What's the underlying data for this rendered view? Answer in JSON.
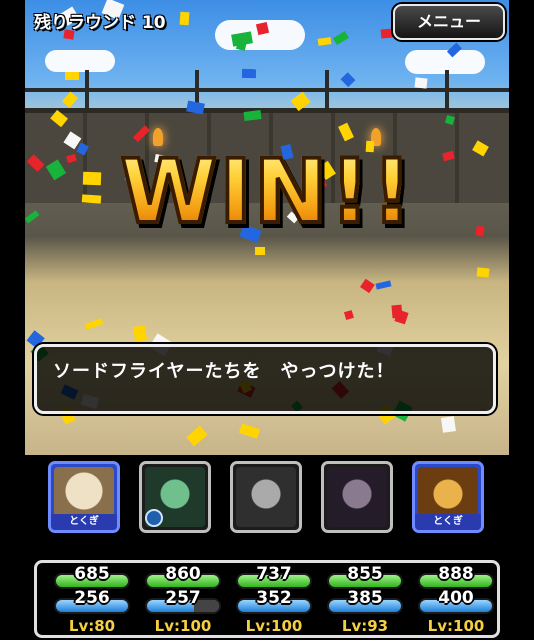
{
  "header": {
    "rounds_left": "残りラウンド 10",
    "menu_label": "メニュー"
  },
  "banner": {
    "text": "WIN!!"
  },
  "message": {
    "text": "ソードフライヤーたちを　やっつけた！"
  },
  "party": [
    {
      "name": "skeleton-monster",
      "frame": "blue",
      "special_label": "とくぎ",
      "hp": "685",
      "mp": "256",
      "mp_fraction": 1.0,
      "level": "Lv:80",
      "face_color": "#d8c7a8"
    },
    {
      "name": "green-witch-monster",
      "frame": "grey",
      "special_label": "",
      "hp": "860",
      "mp": "257",
      "mp_fraction": 0.65,
      "level": "Lv:100",
      "face_color": "#3c6b4a"
    },
    {
      "name": "grey-dragon-monster",
      "frame": "grey",
      "special_label": "",
      "hp": "737",
      "mp": "352",
      "mp_fraction": 1.0,
      "level": "Lv:100",
      "face_color": "#5b5b5b"
    },
    {
      "name": "dark-skull-monster",
      "frame": "grey",
      "special_label": "",
      "hp": "855",
      "mp": "385",
      "mp_fraction": 1.0,
      "level": "Lv:93",
      "face_color": "#3a3040"
    },
    {
      "name": "horned-helmet-monster",
      "frame": "blue",
      "special_label": "とくぎ",
      "hp": "888",
      "mp": "400",
      "mp_fraction": 1.0,
      "level": "Lv:100",
      "face_color": "#c98b2a"
    }
  ]
}
